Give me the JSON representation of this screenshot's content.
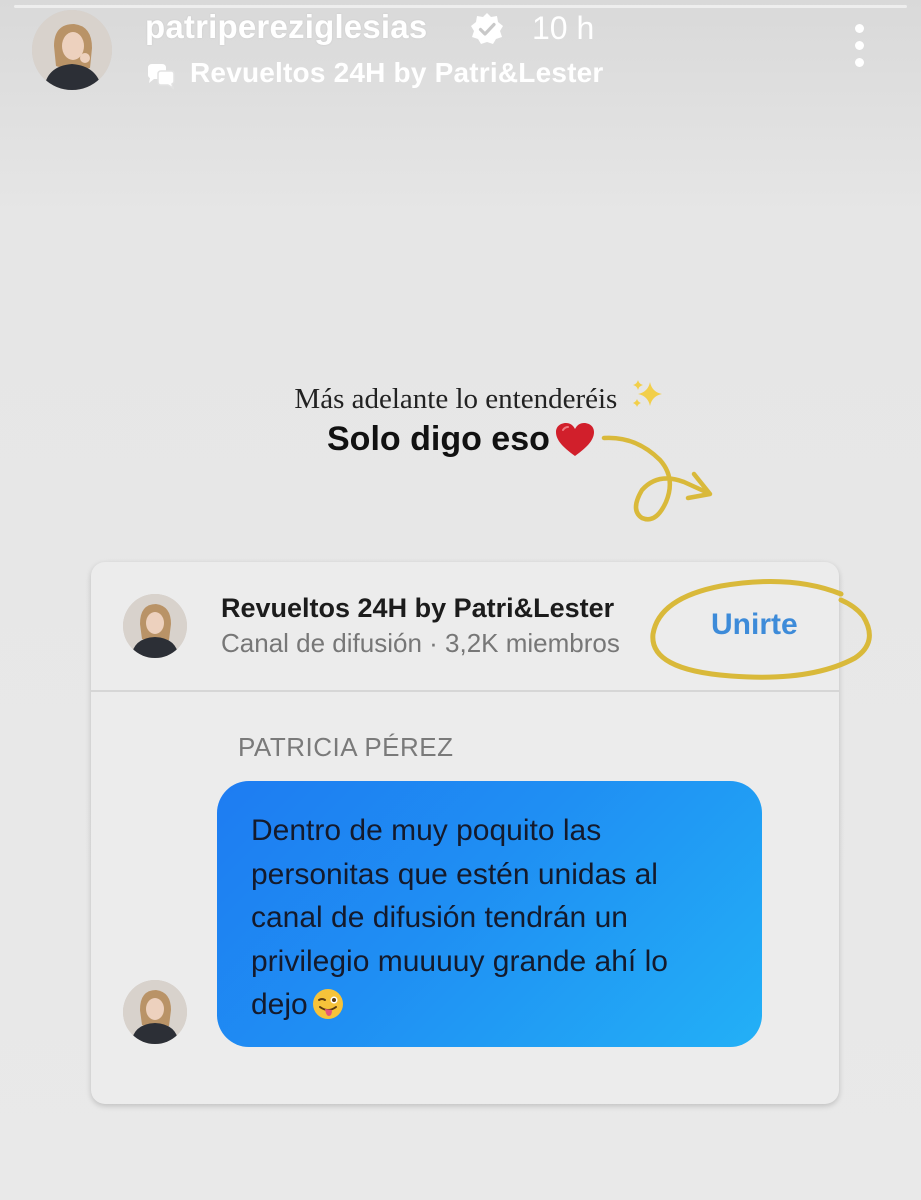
{
  "header": {
    "username": "patripereziglesias",
    "time_ago": "10 h",
    "channel_label": "Revueltos 24H by Patri&Lester",
    "avatar_icon": "profile-avatar-icon",
    "verified_icon": "verified-badge-icon",
    "channel_icon": "broadcast-channel-icon",
    "more_icon": "more-options-icon"
  },
  "caption": {
    "line1": "Más adelante lo entenderéis",
    "line2": "Solo digo eso",
    "sparkles_icon": "sparkles-icon",
    "heart_icon": "red-heart-icon",
    "arrow_icon": "arrow-doodle-icon"
  },
  "card": {
    "title": "Revueltos 24H by Patri&Lester",
    "subtitle": "Canal de difusión · 3,2K miembros",
    "join_label": "Unirte",
    "sender": "PATRICIA PÉREZ",
    "message": "Dentro de muy poquito las\npersonitas que estén unidas al\ncanal de difusión tendrán un\nprivilegio muuuuy grande ahí lo\ndejo",
    "wink_icon": "winking-tongue-emoji-icon"
  },
  "colors": {
    "background": "#e6e6e6",
    "join_blue": "#3d8bd9",
    "bubble_start": "#1e7cf2",
    "bubble_end": "#23b0f6",
    "doodle_yellow": "#d9b93a",
    "heart_red": "#d11f2b"
  }
}
